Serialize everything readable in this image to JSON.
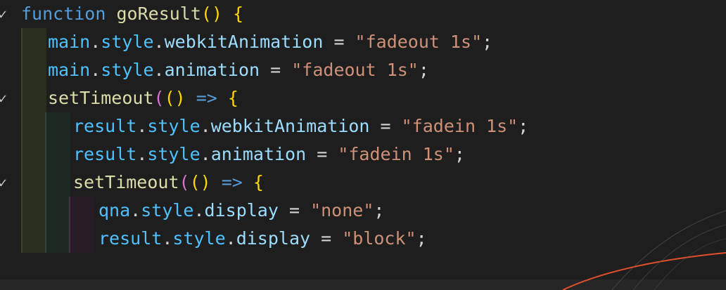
{
  "lines": [
    {
      "fold": "✓",
      "parts": [
        {
          "t": "function",
          "c": "kw"
        },
        {
          "t": " ",
          "c": "punc"
        },
        {
          "t": "goResult",
          "c": "fn"
        },
        {
          "t": "()",
          "c": "brace1"
        },
        {
          "t": " ",
          "c": "punc"
        },
        {
          "t": "{",
          "c": "brace1"
        }
      ]
    },
    {
      "fold": "",
      "parts": [
        {
          "t": "main",
          "c": "var"
        },
        {
          "t": ".",
          "c": "punc"
        },
        {
          "t": "style",
          "c": "var"
        },
        {
          "t": ".",
          "c": "punc"
        },
        {
          "t": "webkitAnimation",
          "c": "prop"
        },
        {
          "t": " = ",
          "c": "punc"
        },
        {
          "t": "\"fadeout 1s\"",
          "c": "str"
        },
        {
          "t": ";",
          "c": "punc"
        }
      ]
    },
    {
      "fold": "",
      "parts": [
        {
          "t": "main",
          "c": "var"
        },
        {
          "t": ".",
          "c": "punc"
        },
        {
          "t": "style",
          "c": "var"
        },
        {
          "t": ".",
          "c": "punc"
        },
        {
          "t": "animation",
          "c": "prop"
        },
        {
          "t": " = ",
          "c": "punc"
        },
        {
          "t": "\"fadeout 1s\"",
          "c": "str"
        },
        {
          "t": ";",
          "c": "punc"
        }
      ]
    },
    {
      "fold": "✓",
      "parts": [
        {
          "t": "setTimeout",
          "c": "fn"
        },
        {
          "t": "(",
          "c": "brace2"
        },
        {
          "t": "()",
          "c": "brace1"
        },
        {
          "t": " ",
          "c": "punc"
        },
        {
          "t": "=>",
          "c": "arrow"
        },
        {
          "t": " ",
          "c": "punc"
        },
        {
          "t": "{",
          "c": "brace1"
        }
      ]
    },
    {
      "fold": "",
      "parts": [
        {
          "t": "result",
          "c": "var"
        },
        {
          "t": ".",
          "c": "punc"
        },
        {
          "t": "style",
          "c": "var"
        },
        {
          "t": ".",
          "c": "punc"
        },
        {
          "t": "webkitAnimation",
          "c": "prop"
        },
        {
          "t": " = ",
          "c": "punc"
        },
        {
          "t": "\"fadein 1s\"",
          "c": "str"
        },
        {
          "t": ";",
          "c": "punc"
        }
      ]
    },
    {
      "fold": "",
      "parts": [
        {
          "t": "result",
          "c": "var"
        },
        {
          "t": ".",
          "c": "punc"
        },
        {
          "t": "style",
          "c": "var"
        },
        {
          "t": ".",
          "c": "punc"
        },
        {
          "t": "animation",
          "c": "prop"
        },
        {
          "t": " = ",
          "c": "punc"
        },
        {
          "t": "\"fadein 1s\"",
          "c": "str"
        },
        {
          "t": ";",
          "c": "punc"
        }
      ]
    },
    {
      "fold": "✓",
      "parts": [
        {
          "t": "setTimeout",
          "c": "fn"
        },
        {
          "t": "(",
          "c": "brace2"
        },
        {
          "t": "()",
          "c": "brace1"
        },
        {
          "t": " ",
          "c": "punc"
        },
        {
          "t": "=>",
          "c": "arrow"
        },
        {
          "t": " ",
          "c": "punc"
        },
        {
          "t": "{",
          "c": "brace1"
        }
      ]
    },
    {
      "fold": "",
      "parts": [
        {
          "t": "qna",
          "c": "var"
        },
        {
          "t": ".",
          "c": "punc"
        },
        {
          "t": "style",
          "c": "var"
        },
        {
          "t": ".",
          "c": "punc"
        },
        {
          "t": "display",
          "c": "prop"
        },
        {
          "t": " = ",
          "c": "punc"
        },
        {
          "t": "\"none\"",
          "c": "str"
        },
        {
          "t": ";",
          "c": "punc"
        }
      ]
    },
    {
      "fold": "",
      "parts": [
        {
          "t": "result",
          "c": "var"
        },
        {
          "t": ".",
          "c": "punc"
        },
        {
          "t": "style",
          "c": "var"
        },
        {
          "t": ".",
          "c": "punc"
        },
        {
          "t": "display",
          "c": "prop"
        },
        {
          "t": " = ",
          "c": "punc"
        },
        {
          "t": "\"block\"",
          "c": "str"
        },
        {
          "t": ";",
          "c": "punc"
        }
      ]
    }
  ],
  "colors": {
    "background": "#1e1e1e",
    "keyword": "#569cd6",
    "function": "#dcdcaa",
    "variable": "#4fc1ff",
    "property": "#9cdcfe",
    "string": "#ce9178",
    "bracket_gold": "#ffd700",
    "bracket_orchid": "#da70d6",
    "decoration_orange": "#e0502a"
  }
}
